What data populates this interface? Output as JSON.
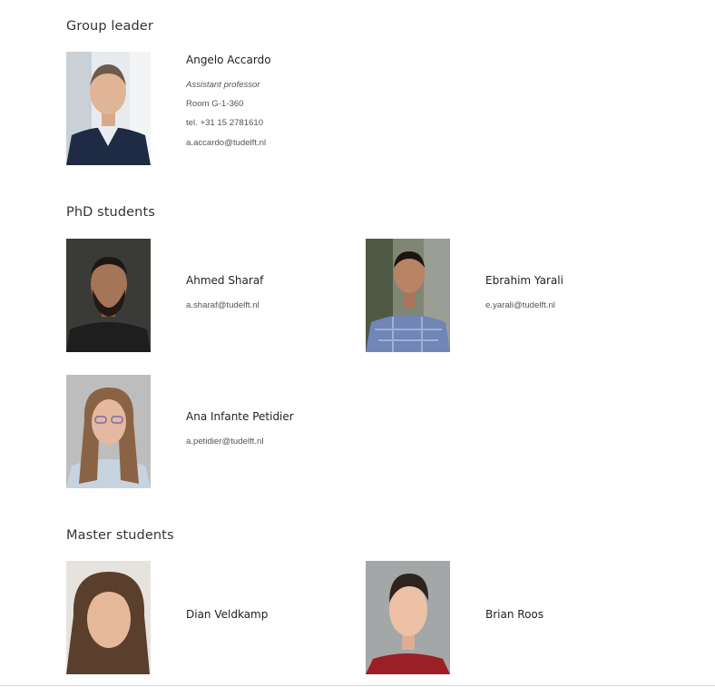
{
  "sections": {
    "leader_title": "Group leader",
    "phd_title": "PhD students",
    "master_title": "Master students"
  },
  "leader": {
    "name": "Angelo Accardo",
    "role": "Assistant professor",
    "room": "Room G-1-360",
    "phone": "tel. +31 15 2781610",
    "email": "a.accardo@tudelft.nl"
  },
  "phd": [
    {
      "name": "Ahmed Sharaf",
      "email": "a.sharaf@tudelft.nl"
    },
    {
      "name": "Ebrahim Yarali",
      "email": "e.yarali@tudelft.nl"
    },
    {
      "name": "Ana Infante Petidier",
      "email": "a.petidier@tudelft.nl"
    }
  ],
  "master": [
    {
      "name": "Dian Veldkamp"
    },
    {
      "name": "Brian Roos"
    }
  ]
}
